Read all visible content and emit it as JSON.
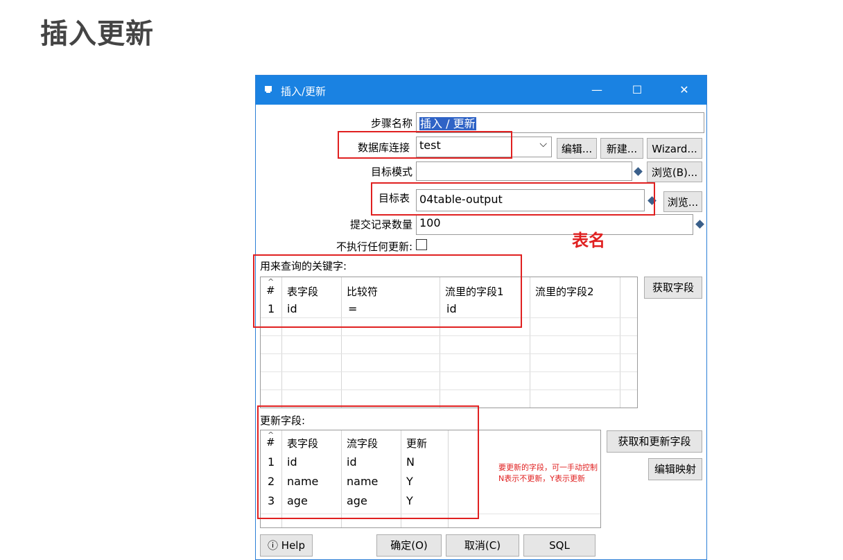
{
  "slide_title": "插入更新",
  "window": {
    "title": "插入/更新",
    "controls": {
      "minimize": "—",
      "maximize": "☐",
      "close": "✕"
    }
  },
  "form": {
    "step_name_label": "步骤名称",
    "step_name_value": "插入 / 更新",
    "db_conn_label": "数据库连接",
    "db_conn_value": "test",
    "edit_btn": "编辑...",
    "new_btn": "新建...",
    "wizard_btn": "Wizard...",
    "target_schema_label": "目标模式",
    "target_schema_value": "",
    "browse_schema_btn": "浏览(B)...",
    "target_table_label": "目标表",
    "target_table_value": "04table-output",
    "browse_table_btn": "浏览...",
    "commit_size_label": "提交记录数量",
    "commit_size_value": "100",
    "no_update_label": "不执行任何更新:"
  },
  "annotations": {
    "table_name": "表名",
    "update_note_line1": "要更新的字段，可一手动控制",
    "update_note_line2": "N表示不更新，Y表示更新"
  },
  "lookup": {
    "section_label": "用来查询的关键字:",
    "get_fields_btn": "获取字段",
    "columns": [
      "#",
      "表字段",
      "比较符",
      "流里的字段1",
      "流里的字段2"
    ],
    "rows": [
      {
        "num": "1",
        "table_field": "id",
        "comparator": "=",
        "stream1": "id",
        "stream2": ""
      }
    ]
  },
  "update": {
    "section_label": "更新字段:",
    "get_update_btn": "获取和更新字段",
    "edit_mapping_btn": "编辑映射",
    "columns": [
      "#",
      "表字段",
      "流字段",
      "更新"
    ],
    "rows": [
      {
        "num": "1",
        "table_field": "id",
        "stream_field": "id",
        "update": "N"
      },
      {
        "num": "2",
        "table_field": "name",
        "stream_field": "name",
        "update": "Y"
      },
      {
        "num": "3",
        "table_field": "age",
        "stream_field": "age",
        "update": "Y"
      }
    ]
  },
  "footer": {
    "help": "Help",
    "ok": "确定(O)",
    "cancel": "取消(C)",
    "sql": "SQL"
  },
  "colors": {
    "titlebar": "#1a82e2",
    "annotation_red": "#e02020"
  }
}
